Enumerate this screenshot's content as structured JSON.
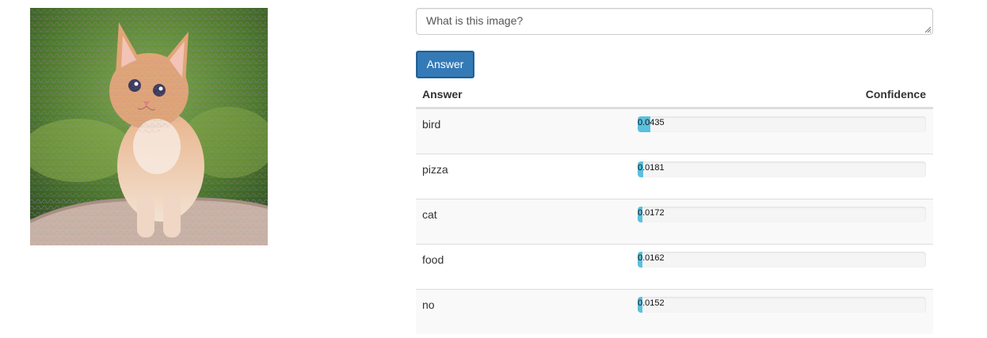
{
  "question": {
    "value": "What is this image?"
  },
  "answer_button": {
    "label": "Answer"
  },
  "results": {
    "headers": {
      "answer": "Answer",
      "confidence": "Confidence"
    },
    "rows": [
      {
        "answer": "bird",
        "confidence": "0.0435",
        "value": 0.0435
      },
      {
        "answer": "pizza",
        "confidence": "0.0181",
        "value": 0.0181
      },
      {
        "answer": "cat",
        "confidence": "0.0172",
        "value": 0.0172
      },
      {
        "answer": "food",
        "confidence": "0.0162",
        "value": 0.0162
      },
      {
        "answer": "no",
        "confidence": "0.0152",
        "value": 0.0152
      }
    ]
  },
  "colors": {
    "primary_button": "#337ab7",
    "progress_fill": "#5bc0de",
    "progress_track": "#f5f5f5"
  }
}
